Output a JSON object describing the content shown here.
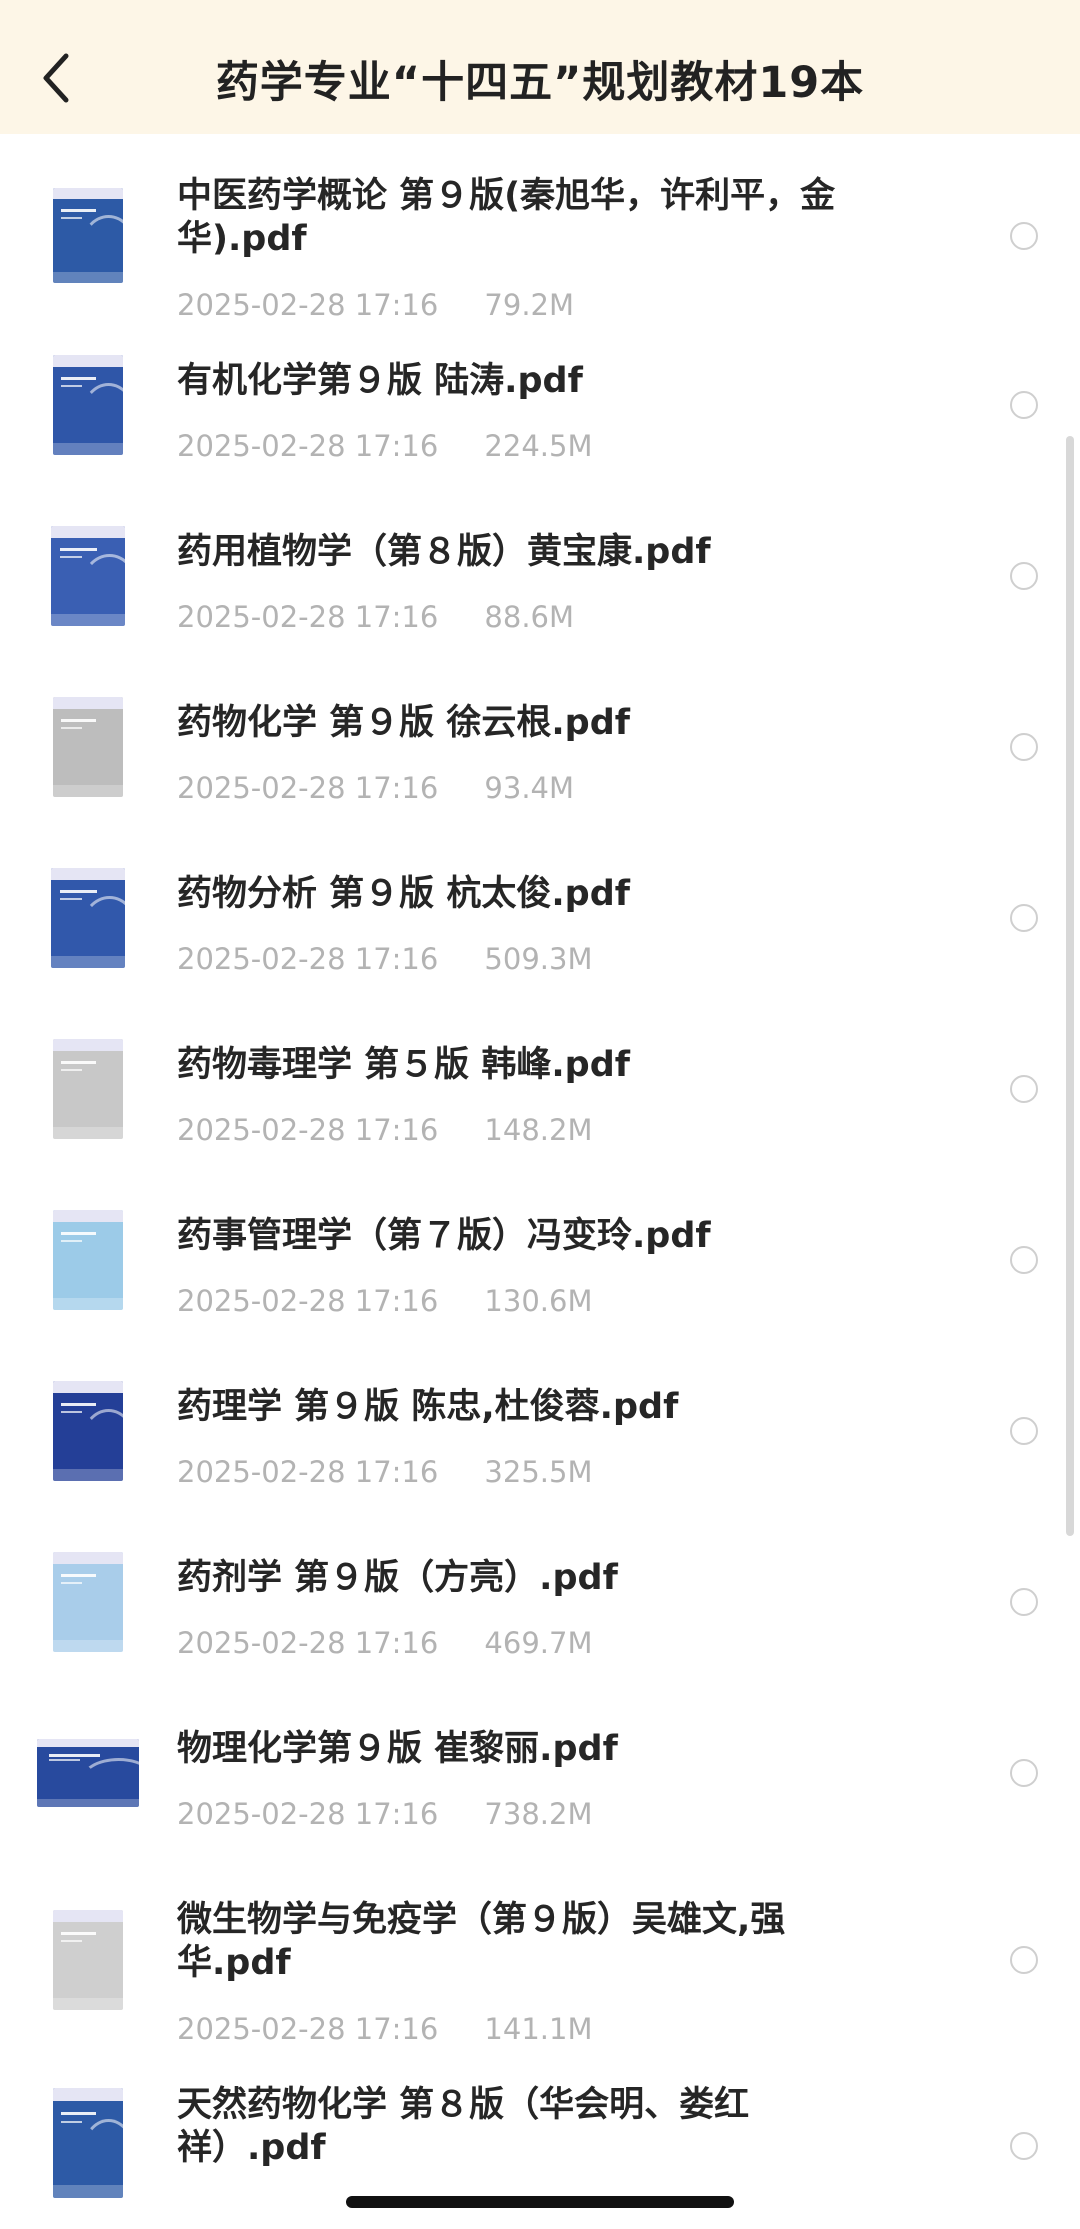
{
  "header": {
    "title": "药学专业“十四五”规划教材19本",
    "back_icon": "chevron-left-icon"
  },
  "files": [
    {
      "name": "中医药学概论 第９版(秦旭华，许利平，金华).pdf",
      "date": "2025-02-28 17:16",
      "size": "79.2M",
      "cover": "#2d5aa6"
    },
    {
      "name": "有机化学第９版 陆涛.pdf",
      "date": "2025-02-28 17:16",
      "size": "224.5M",
      "cover": "#2f56a8"
    },
    {
      "name": "药用植物学（第８版）黄宝康.pdf",
      "date": "2025-02-28 17:16",
      "size": "88.6M",
      "cover": "#3a5fb3"
    },
    {
      "name": "药物化学 第９版 徐云根.pdf",
      "date": "2025-02-28 17:16",
      "size": "93.4M",
      "cover": "#bdbdbd"
    },
    {
      "name": "药物分析 第９版 杭太俊.pdf",
      "date": "2025-02-28 17:16",
      "size": "509.3M",
      "cover": "#3158ab"
    },
    {
      "name": "药物毒理学 第５版 韩峰.pdf",
      "date": "2025-02-28 17:16",
      "size": "148.2M",
      "cover": "#c8c8c8"
    },
    {
      "name": "药事管理学（第７版）冯变玲.pdf",
      "date": "2025-02-28 17:16",
      "size": "130.6M",
      "cover": "#9ccbe8"
    },
    {
      "name": "药理学 第９版 陈忠,杜俊蓉.pdf",
      "date": "2025-02-28 17:16",
      "size": "325.5M",
      "cover": "#243f97"
    },
    {
      "name": "药剂学 第９版（方亮）.pdf",
      "date": "2025-02-28 17:16",
      "size": "469.7M",
      "cover": "#a9cdea"
    },
    {
      "name": "物理化学第９版 崔黎丽.pdf",
      "date": "2025-02-28 17:16",
      "size": "738.2M",
      "cover": "#284a9e"
    },
    {
      "name": "微生物学与免疫学（第９版）吴雄文,强华.pdf",
      "date": "2025-02-28 17:16",
      "size": "141.1M",
      "cover": "#cfcfcf"
    },
    {
      "name": "天然药物化学 第８版（华会明、娄红祥）.pdf",
      "date": "",
      "size": "",
      "cover": "#2d5aa6"
    }
  ]
}
